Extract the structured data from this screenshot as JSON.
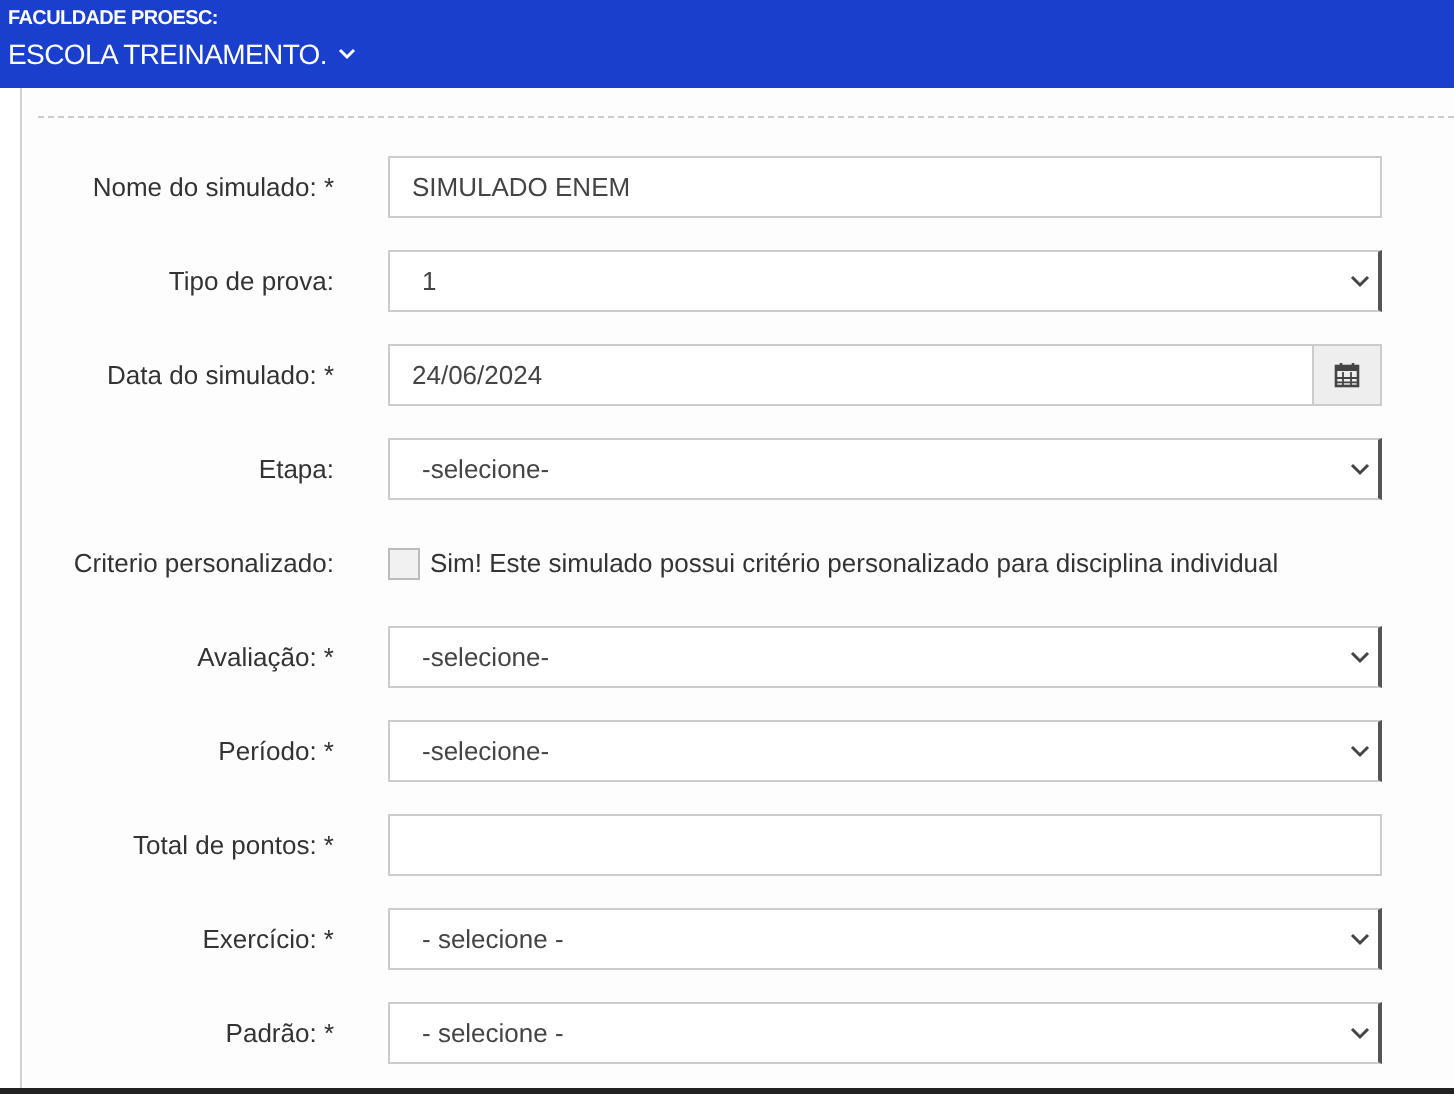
{
  "header": {
    "institution": "FACULDADE PROESC:",
    "school": "ESCOLA TREINAMENTO."
  },
  "fields": [
    {
      "kind": "text",
      "label": "Nome do simulado: *",
      "value": "SIMULADO ENEM"
    },
    {
      "kind": "select",
      "label": "Tipo de prova:",
      "value": "1"
    },
    {
      "kind": "date",
      "label": "Data do simulado: *",
      "value": "24/06/2024"
    },
    {
      "kind": "select",
      "label": "Etapa:",
      "value": "-selecione-"
    },
    {
      "kind": "checkbox",
      "label": "Criterio personalizado:",
      "text": "Sim! Este simulado possui critério personalizado para disciplina individual",
      "checked": false
    },
    {
      "kind": "select",
      "label": "Avaliação: *",
      "value": "-selecione-"
    },
    {
      "kind": "select",
      "label": "Período: *",
      "value": "-selecione-"
    },
    {
      "kind": "text",
      "label": "Total de pontos: *"
    },
    {
      "kind": "select",
      "label": "Exercício: *",
      "value": "- selecione -"
    },
    {
      "kind": "select",
      "label": "Padrão: *",
      "value": "- selecione -"
    }
  ]
}
